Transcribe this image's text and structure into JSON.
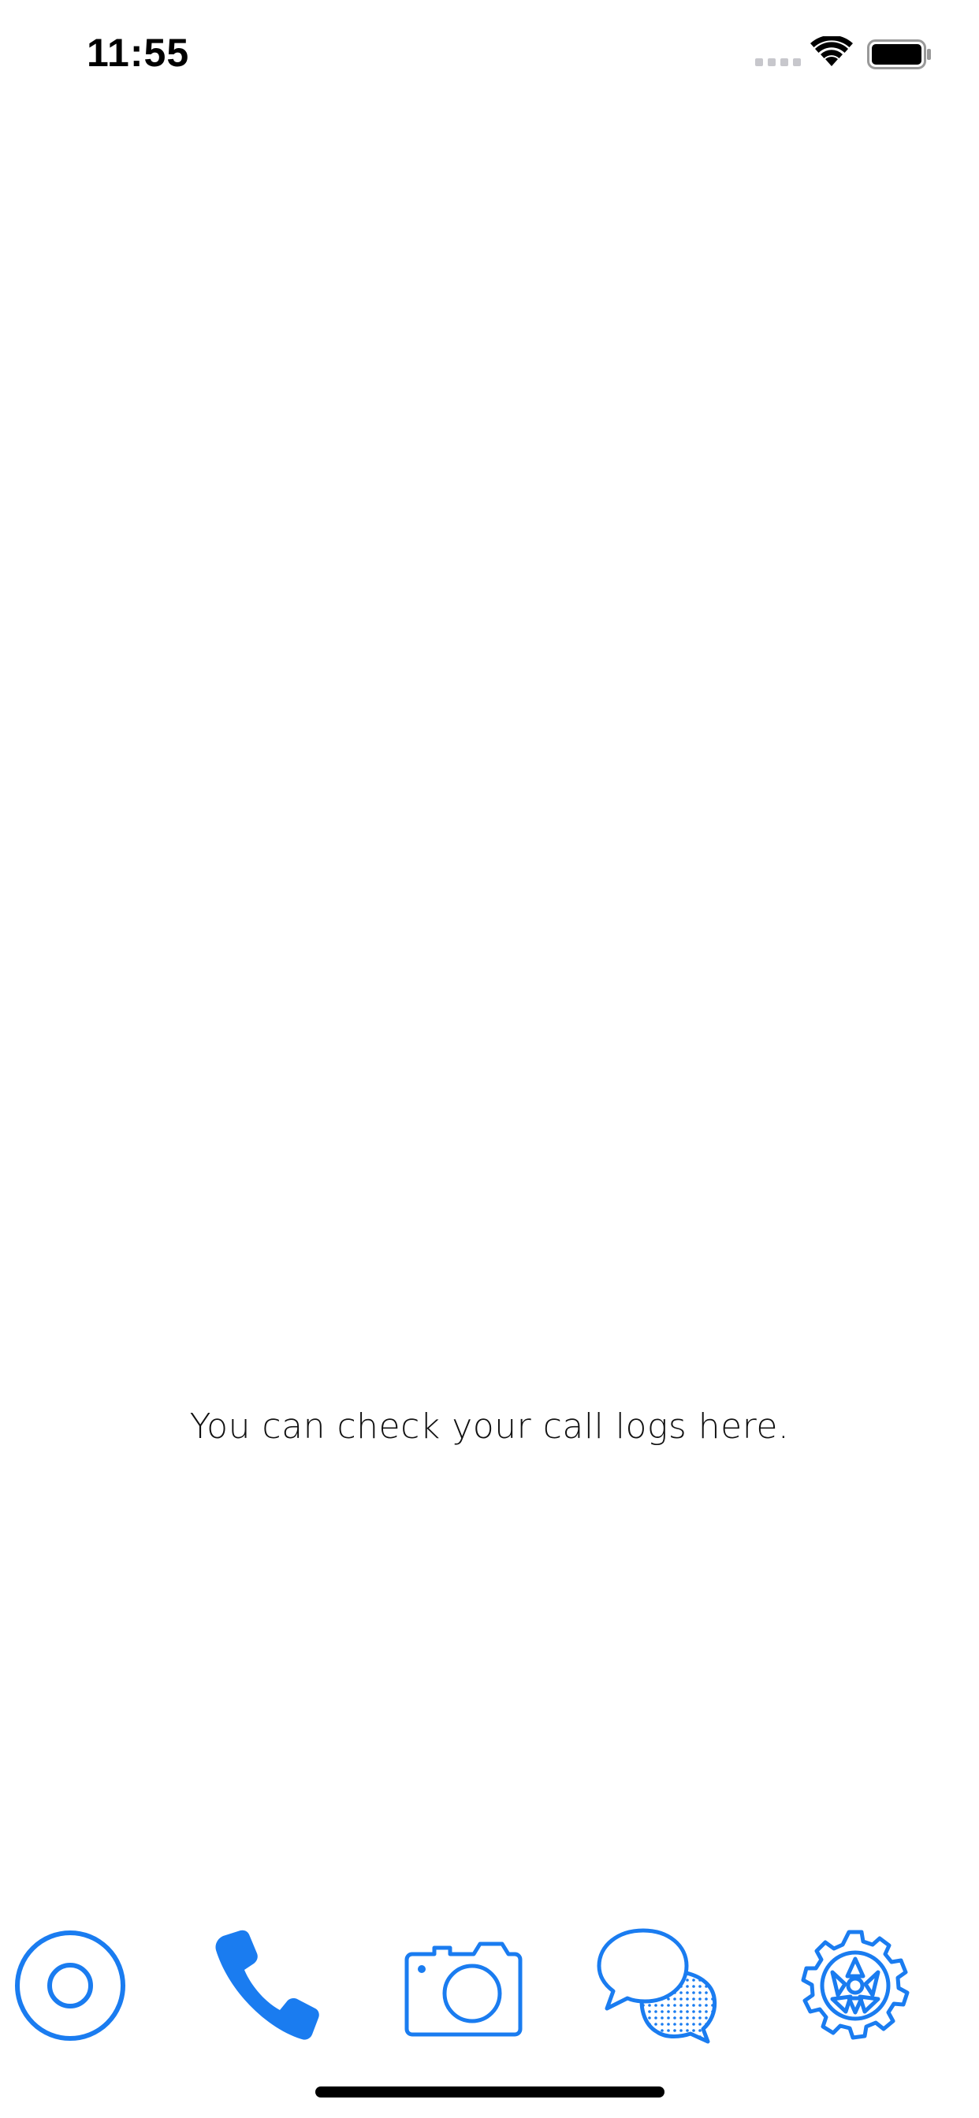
{
  "status_bar": {
    "time": "11:55",
    "signal_icon": "signal-bars-icon",
    "wifi_icon": "wifi-icon",
    "battery_icon": "battery-icon"
  },
  "main": {
    "empty_message": "You can check your call logs here."
  },
  "tab_bar": {
    "accent_color": "#1a7cf0",
    "tabs": [
      {
        "icon": "radio-target-icon",
        "selected": false
      },
      {
        "icon": "phone-icon",
        "selected": true
      },
      {
        "icon": "camera-icon",
        "selected": false
      },
      {
        "icon": "chat-bubbles-icon",
        "selected": false
      },
      {
        "icon": "gear-icon",
        "selected": false
      }
    ]
  }
}
